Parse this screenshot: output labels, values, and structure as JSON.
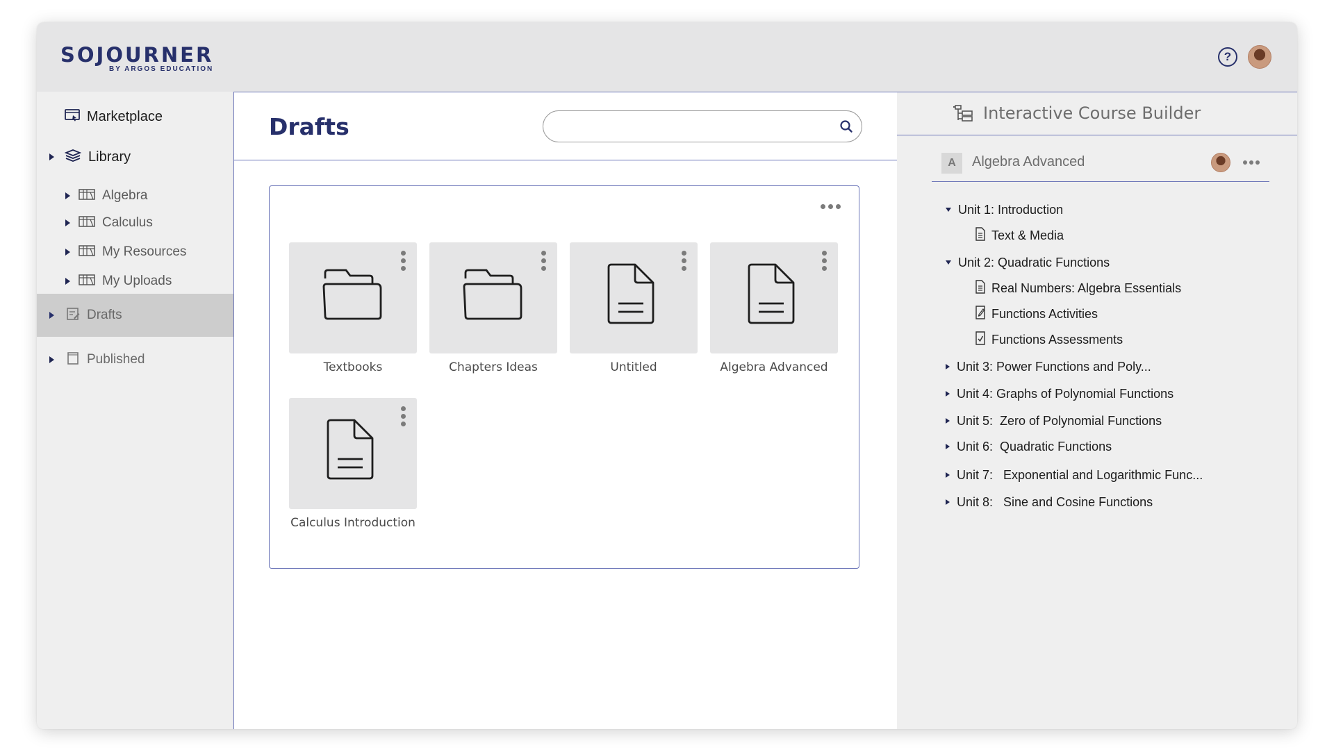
{
  "app": {
    "brand": "SOJOURNER",
    "brand_sub": "BY ARGOS EDUCATION",
    "help_glyph": "?"
  },
  "sidebar": {
    "marketplace": "Marketplace",
    "library": "Library",
    "library_items": [
      {
        "label": "Algebra"
      },
      {
        "label": "Calculus"
      },
      {
        "label": "My Resources"
      },
      {
        "label": "My Uploads"
      }
    ],
    "drafts": "Drafts",
    "published": "Published"
  },
  "main": {
    "title": "Drafts",
    "search": {
      "placeholder": "",
      "value": ""
    },
    "items": [
      {
        "label": "Textbooks",
        "type": "folder-icon"
      },
      {
        "label": "Chapters Ideas",
        "type": "folder-icon"
      },
      {
        "label": "Untitled",
        "type": "document-icon"
      },
      {
        "label": "Algebra Advanced",
        "type": "document-icon"
      },
      {
        "label": "Calculus Introduction",
        "type": "document-icon"
      }
    ]
  },
  "builder": {
    "title": "Interactive Course Builder",
    "course_badge": "A",
    "course_name": "Algebra Advanced",
    "units": [
      {
        "label": "Unit 1: Introduction",
        "expanded": true
      },
      {
        "label": "Text & Media",
        "leaf": "document-icon"
      },
      {
        "label": "Unit 2: Quadratic Functions",
        "expanded": true
      },
      {
        "label": "Real Numbers: Algebra Essentials",
        "leaf": "document-icon"
      },
      {
        "label": "Functions Activities",
        "leaf": "edit-document-icon"
      },
      {
        "label": "Functions Assessments",
        "leaf": "checklist-icon"
      },
      {
        "label": "Unit 3: Power Functions and Poly...",
        "expanded": false
      },
      {
        "label": "Unit 4: Graphs of Polynomial Functions",
        "expanded": false
      },
      {
        "label": "Unit 5:  Zero of Polynomial Functions",
        "expanded": false
      },
      {
        "label": "Unit 6:  Quadratic Functions",
        "expanded": false
      },
      {
        "label": "Unit 7:   Exponential and Logarithmic Func...",
        "expanded": false
      },
      {
        "label": "Unit 8:   Sine and Cosine Functions",
        "expanded": false
      }
    ]
  },
  "colors": {
    "brand": "#27306b",
    "accent_border": "#6b75b8",
    "active_nav": "#cdcdcd",
    "tile_bg": "#e5e5e6"
  }
}
